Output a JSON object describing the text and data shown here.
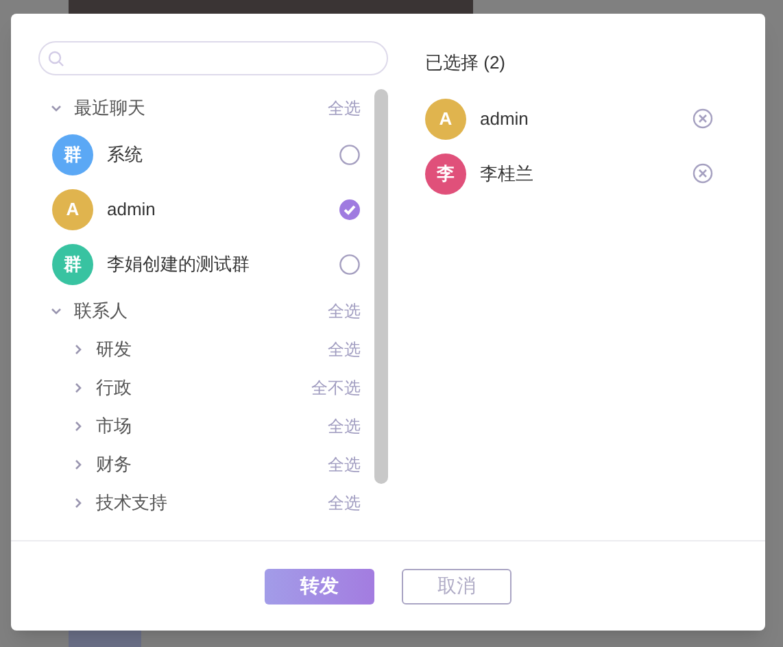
{
  "groups": [
    {
      "title": "最近聊天",
      "expanded": true,
      "action": "全选",
      "kind": "chats",
      "items": [
        {
          "avatar": "群",
          "name": "系统",
          "color": "#5ba8f5",
          "checked": false
        },
        {
          "avatar": "A",
          "name": "admin",
          "color": "#e0b44e",
          "checked": true
        },
        {
          "avatar": "群",
          "name": "李娟创建的测试群",
          "color": "#38c3a1",
          "checked": false
        }
      ]
    },
    {
      "title": "联系人",
      "expanded": true,
      "action": "全选",
      "kind": "departments",
      "items": [
        {
          "name": "研发",
          "expanded": false,
          "action": "全选"
        },
        {
          "name": "行政",
          "expanded": false,
          "action": "全不选"
        },
        {
          "name": "市场",
          "expanded": false,
          "action": "全选"
        },
        {
          "name": "财务",
          "expanded": false,
          "action": "全选"
        },
        {
          "name": "技术支持",
          "expanded": false,
          "action": "全选"
        }
      ]
    }
  ],
  "selected_title": "已选择 (2)",
  "selected": [
    {
      "avatar": "A",
      "name": "admin",
      "color": "#e0b44e"
    },
    {
      "avatar": "李",
      "name": "李桂兰",
      "color": "#e0507a"
    }
  ],
  "buttons": {
    "confirm": "转发",
    "cancel": "取消"
  }
}
